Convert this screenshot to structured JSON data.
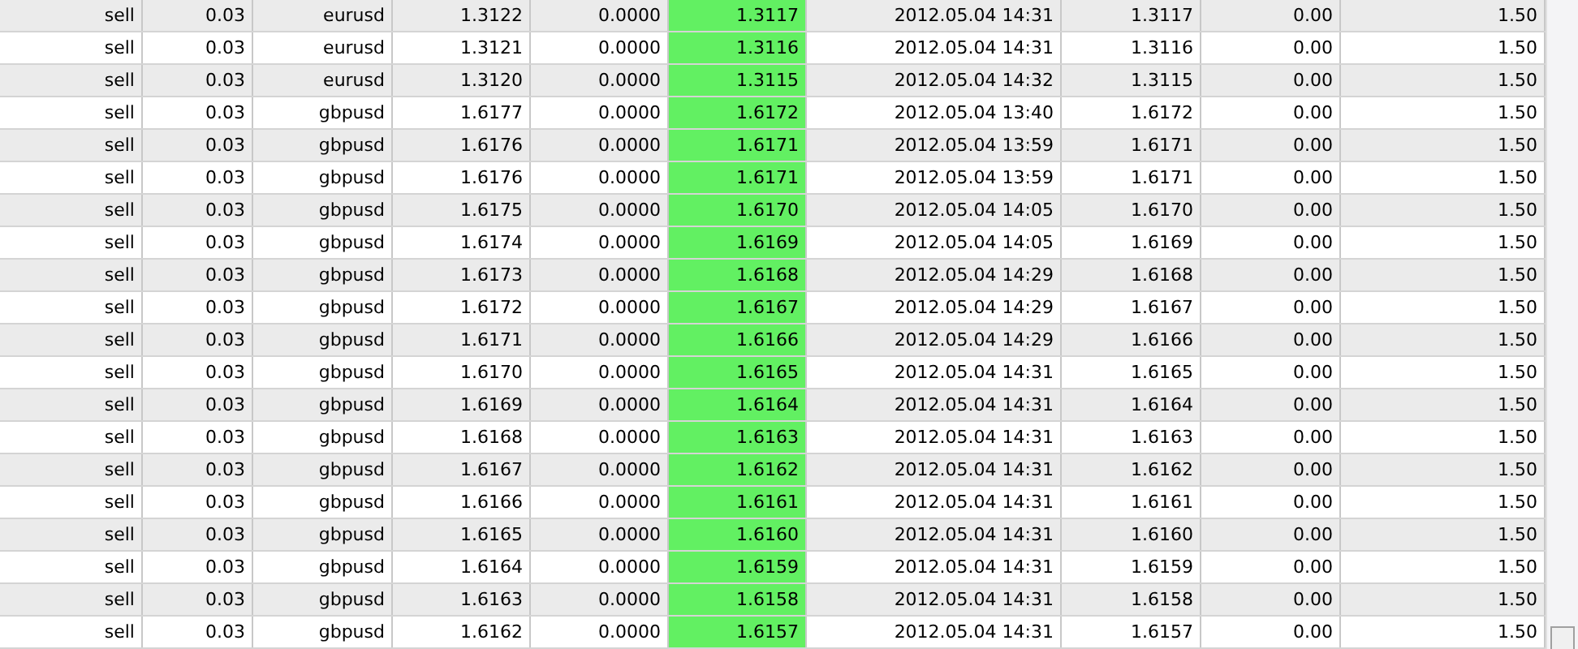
{
  "columns": [
    {
      "highlighted": false
    },
    {
      "highlighted": false
    },
    {
      "highlighted": false
    },
    {
      "highlighted": false
    },
    {
      "highlighted": false
    },
    {
      "highlighted": true
    },
    {
      "highlighted": false
    },
    {
      "highlighted": false
    },
    {
      "highlighted": false
    },
    {
      "highlighted": false
    }
  ],
  "rows": [
    [
      "sell",
      "0.03",
      "eurusd",
      "1.3122",
      "0.0000",
      "1.3117",
      "2012.05.04 14:31",
      "1.3117",
      "0.00",
      "1.50"
    ],
    [
      "sell",
      "0.03",
      "eurusd",
      "1.3121",
      "0.0000",
      "1.3116",
      "2012.05.04 14:31",
      "1.3116",
      "0.00",
      "1.50"
    ],
    [
      "sell",
      "0.03",
      "eurusd",
      "1.3120",
      "0.0000",
      "1.3115",
      "2012.05.04 14:32",
      "1.3115",
      "0.00",
      "1.50"
    ],
    [
      "sell",
      "0.03",
      "gbpusd",
      "1.6177",
      "0.0000",
      "1.6172",
      "2012.05.04 13:40",
      "1.6172",
      "0.00",
      "1.50"
    ],
    [
      "sell",
      "0.03",
      "gbpusd",
      "1.6176",
      "0.0000",
      "1.6171",
      "2012.05.04 13:59",
      "1.6171",
      "0.00",
      "1.50"
    ],
    [
      "sell",
      "0.03",
      "gbpusd",
      "1.6176",
      "0.0000",
      "1.6171",
      "2012.05.04 13:59",
      "1.6171",
      "0.00",
      "1.50"
    ],
    [
      "sell",
      "0.03",
      "gbpusd",
      "1.6175",
      "0.0000",
      "1.6170",
      "2012.05.04 14:05",
      "1.6170",
      "0.00",
      "1.50"
    ],
    [
      "sell",
      "0.03",
      "gbpusd",
      "1.6174",
      "0.0000",
      "1.6169",
      "2012.05.04 14:05",
      "1.6169",
      "0.00",
      "1.50"
    ],
    [
      "sell",
      "0.03",
      "gbpusd",
      "1.6173",
      "0.0000",
      "1.6168",
      "2012.05.04 14:29",
      "1.6168",
      "0.00",
      "1.50"
    ],
    [
      "sell",
      "0.03",
      "gbpusd",
      "1.6172",
      "0.0000",
      "1.6167",
      "2012.05.04 14:29",
      "1.6167",
      "0.00",
      "1.50"
    ],
    [
      "sell",
      "0.03",
      "gbpusd",
      "1.6171",
      "0.0000",
      "1.6166",
      "2012.05.04 14:29",
      "1.6166",
      "0.00",
      "1.50"
    ],
    [
      "sell",
      "0.03",
      "gbpusd",
      "1.6170",
      "0.0000",
      "1.6165",
      "2012.05.04 14:31",
      "1.6165",
      "0.00",
      "1.50"
    ],
    [
      "sell",
      "0.03",
      "gbpusd",
      "1.6169",
      "0.0000",
      "1.6164",
      "2012.05.04 14:31",
      "1.6164",
      "0.00",
      "1.50"
    ],
    [
      "sell",
      "0.03",
      "gbpusd",
      "1.6168",
      "0.0000",
      "1.6163",
      "2012.05.04 14:31",
      "1.6163",
      "0.00",
      "1.50"
    ],
    [
      "sell",
      "0.03",
      "gbpusd",
      "1.6167",
      "0.0000",
      "1.6162",
      "2012.05.04 14:31",
      "1.6162",
      "0.00",
      "1.50"
    ],
    [
      "sell",
      "0.03",
      "gbpusd",
      "1.6166",
      "0.0000",
      "1.6161",
      "2012.05.04 14:31",
      "1.6161",
      "0.00",
      "1.50"
    ],
    [
      "sell",
      "0.03",
      "gbpusd",
      "1.6165",
      "0.0000",
      "1.6160",
      "2012.05.04 14:31",
      "1.6160",
      "0.00",
      "1.50"
    ],
    [
      "sell",
      "0.03",
      "gbpusd",
      "1.6164",
      "0.0000",
      "1.6159",
      "2012.05.04 14:31",
      "1.6159",
      "0.00",
      "1.50"
    ],
    [
      "sell",
      "0.03",
      "gbpusd",
      "1.6163",
      "0.0000",
      "1.6158",
      "2012.05.04 14:31",
      "1.6158",
      "0.00",
      "1.50"
    ],
    [
      "sell",
      "0.03",
      "gbpusd",
      "1.6162",
      "0.0000",
      "1.6157",
      "2012.05.04 14:31",
      "1.6157",
      "0.00",
      "1.50"
    ]
  ]
}
